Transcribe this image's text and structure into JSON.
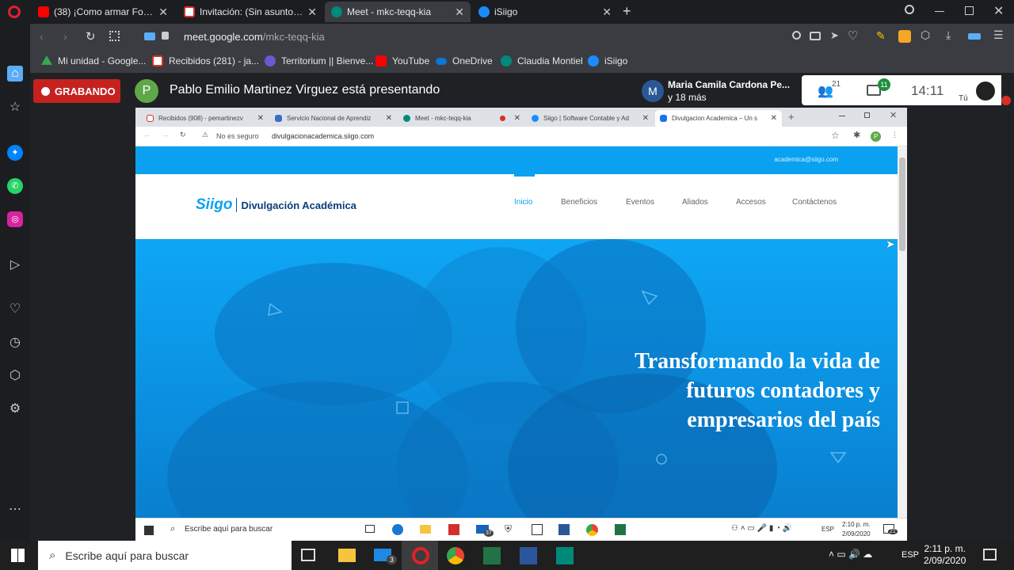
{
  "opera_tabs": [
    {
      "title": "(38) ¡Como armar Formular",
      "color": "#ff0000"
    },
    {
      "title": "Invitación: (Sin asunto) mié",
      "color": "#d93025"
    },
    {
      "title": "Meet - mkc-teqq-kia",
      "color": "#00897b"
    },
    {
      "title": "iSiigo",
      "color": "#1a8cff"
    }
  ],
  "address": {
    "domain": "meet.google.com",
    "path": "/mkc-teqq-kia"
  },
  "bookmarks": [
    {
      "label": "Mi unidad - Google...",
      "color": "#34a853"
    },
    {
      "label": "Recibidos (281) - ja...",
      "color": "#d93025"
    },
    {
      "label": "Territorium || Bienve...",
      "color": "#6a5acd"
    },
    {
      "label": "YouTube",
      "color": "#ff0000"
    },
    {
      "label": "OneDrive",
      "color": "#0a78d4"
    },
    {
      "label": "Claudia Montiel",
      "color": "#00897b"
    },
    {
      "label": "iSiigo",
      "color": "#1a8cff"
    }
  ],
  "meet": {
    "recording_label": "GRABANDO",
    "presenter_initial": "P",
    "presenter_text": "Pablo Emilio Martinez Virguez está presentando",
    "viewer_initial": "M",
    "viewer_name": "Maria Camila Cardona Pe...",
    "viewer_more": "y 18 más",
    "participants_count": "21",
    "chat_count": "11",
    "time": "14:11",
    "you_label": "Tú"
  },
  "inner_tabs": [
    {
      "title": "Recibidos (908) - pemartinezv",
      "color": "#d93025"
    },
    {
      "title": "Servicio Nacional de Aprendiz",
      "color": "#3b6dc4"
    },
    {
      "title": "Meet - mkc-teqq-kia",
      "color": "#00897b"
    },
    {
      "title": "Siigo | Software Contable y Ad",
      "color": "#1a8cff"
    },
    {
      "title": "Divulgacion Academica – Un s",
      "color": "#1a73e8"
    }
  ],
  "inner_address": {
    "security": "No es seguro",
    "url": "divulgacionacademica.siigo.com",
    "profile_initial": "P"
  },
  "site": {
    "email": "academica@siigo.com",
    "logo_mark": "Siigo",
    "logo_text": "Divulgación Académica",
    "nav": [
      "Inicio",
      "Beneficios",
      "Eventos",
      "Aliados",
      "Accesos",
      "Contáctenos"
    ],
    "hero_lines": [
      "Transformando la vida de",
      "futuros contadores y",
      "empresarios del país"
    ]
  },
  "inner_taskbar": {
    "search": "Escribe aquí para buscar",
    "mail_badge": "37",
    "lang": "ESP",
    "time": "2:10 p. m.",
    "date": "2/09/2020",
    "notif": "21"
  },
  "taskbar": {
    "search": "Escribe aquí para buscar",
    "mail_badge": "3",
    "lang": "ESP",
    "time": "2:11 p. m.",
    "date": "2/09/2020"
  }
}
